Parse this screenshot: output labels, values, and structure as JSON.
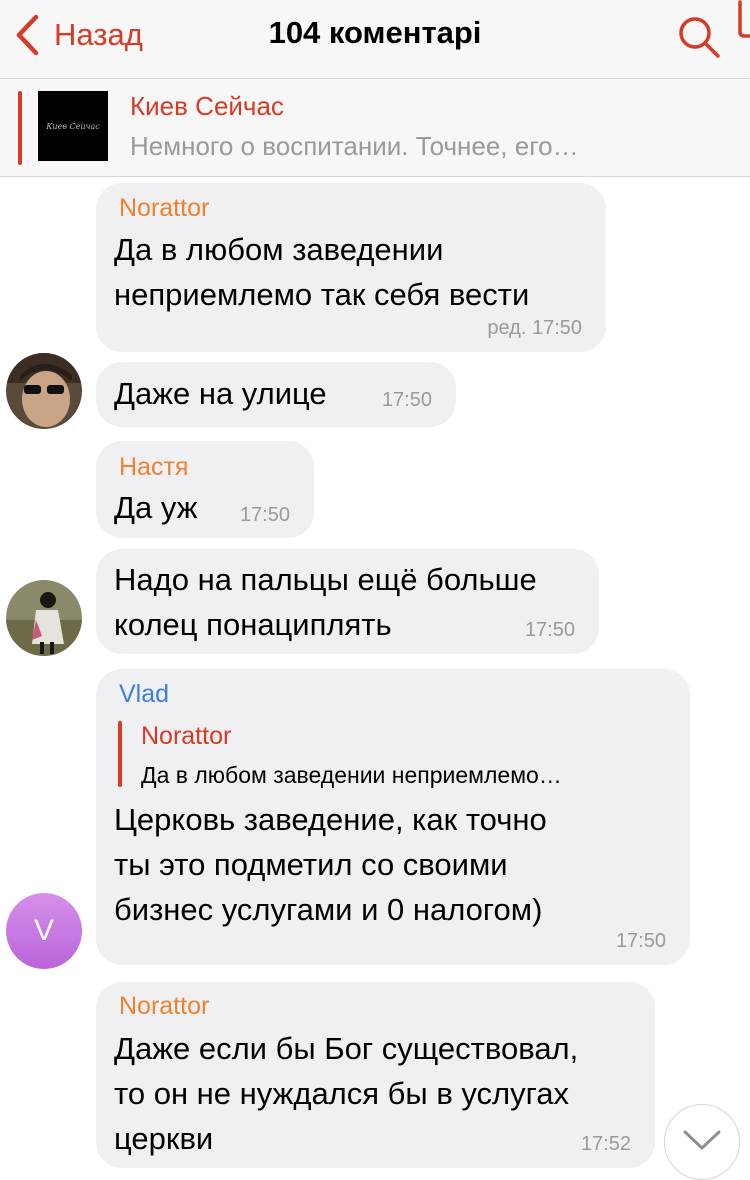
{
  "header": {
    "back_label": "Назад",
    "title": "104 коментарі"
  },
  "pinned": {
    "channel": "Киев Сейчас",
    "thumb_text": "Киев Сейчас",
    "preview": "Немного о воспитании. Точнее,  его…"
  },
  "colors": {
    "accent": "#d83a26",
    "orange_name": "#f0812e",
    "blue_name": "#3e7ed8",
    "bubble": "#f0f0f2"
  },
  "messages": [
    {
      "sender": "Norattor",
      "text": "Да в любом заведении\nнеприемлемо так себя вести",
      "time": "ред. 17:50"
    },
    {
      "sender": "",
      "text": "Даже на улице",
      "time": "17:50"
    },
    {
      "sender": "Настя",
      "text": "Да уж",
      "time": "17:50"
    },
    {
      "sender": "",
      "text": "Надо на пальцы ещё больше\nколец понациплять",
      "time": "17:50"
    },
    {
      "sender": "Vlad",
      "reply_author": "Norattor",
      "reply_text": "Да в любом заведении неприемлемо…",
      "text": "Церковь заведение, как точно\nты это подметил со своими\nбизнес услугами и 0 налогом)",
      "time": "17:50",
      "avatar_letter": "V"
    },
    {
      "sender": "Norattor",
      "text": "Даже если бы Бог существовал,\nто он не нуждался бы в услугах\nцеркви",
      "time": "17:52"
    }
  ],
  "icons": {
    "back": "chevron-left-icon",
    "search": "search-icon",
    "scroll": "chevron-down-icon"
  }
}
